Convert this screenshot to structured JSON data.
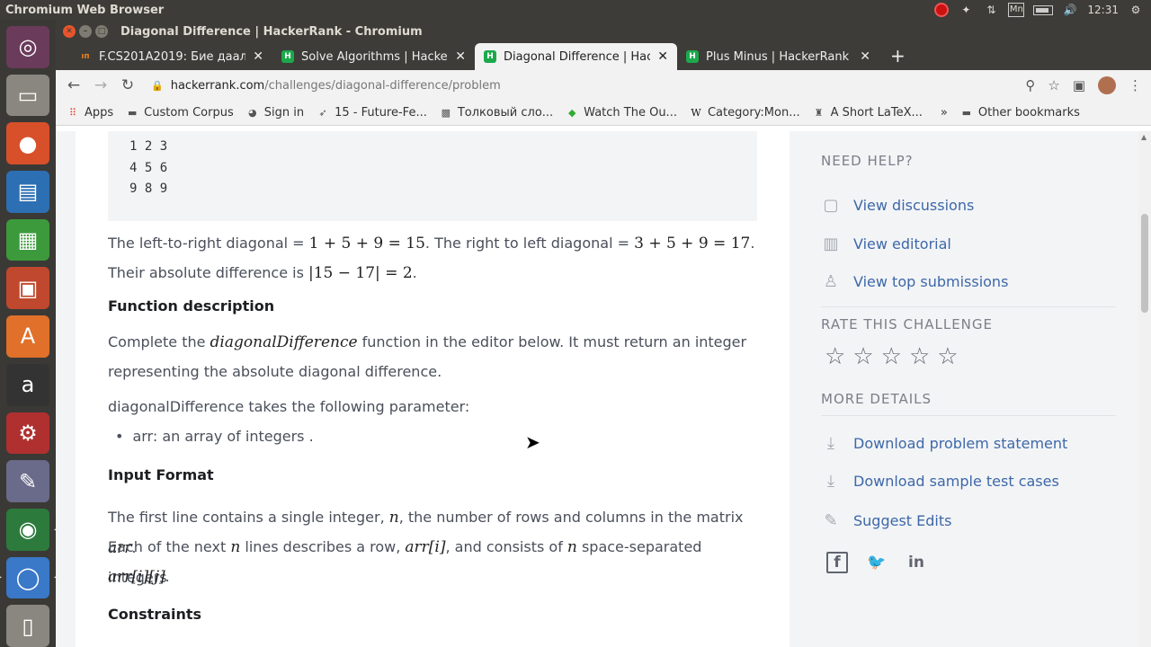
{
  "topbar": {
    "title": "Chromium Web Browser",
    "indicator_mn": "Mn",
    "clock": "12:31"
  },
  "window": {
    "title": "Diagonal Difference | HackerRank - Chromium"
  },
  "tabs": [
    {
      "label": "F.CS201A2019: Бие даалт",
      "icon_color": "#e67e22",
      "icon": "ıп"
    },
    {
      "label": "Solve Algorithms | Hacker",
      "icon_color": "#1ba94c",
      "icon": "H"
    },
    {
      "label": "Diagonal Difference | Hac",
      "icon_color": "#1ba94c",
      "icon": "H"
    },
    {
      "label": "Plus Minus | HackerRank",
      "icon_color": "#1ba94c",
      "icon": "H"
    }
  ],
  "url": {
    "host": "hackerrank.com",
    "path": "/challenges/diagonal-difference/problem"
  },
  "bookmarks": {
    "items": [
      "Apps",
      "Custom Corpus",
      "Sign in",
      "15 - Future-Fe...",
      "Толковый сло...",
      "Watch The Ou...",
      "Category:Mon...",
      "A Short LaTeX..."
    ],
    "more": "»",
    "other": "Other bookmarks"
  },
  "problem": {
    "matrix": [
      "1 2 3",
      "4 5 6",
      "9 8 9"
    ],
    "diag_text1": "The left-to-right diagonal = ",
    "diag_math1": "1 + 5 + 9 = 15",
    "diag_text2": ". The right to left diagonal = ",
    "diag_math2": "3 + 5 + 9 = 17",
    "diag_text3": ".",
    "absdiff_text": "Their absolute difference is ",
    "absdiff_math": "|15 − 17| = 2",
    "absdiff_end": ".",
    "function_heading": "Function description",
    "complete_text1": "Complete the ",
    "complete_math": "diagonalDifference",
    "complete_text2": " function in the editor below. It must return an integer",
    "complete_text3": "representing the absolute diagonal difference.",
    "param_intro": "diagonalDifference takes the following parameter:",
    "param_item": "arr: an array of integers .",
    "input_heading": "Input Format",
    "input_text1": "The first line contains a single integer, ",
    "input_n": "n",
    "input_text2": ", the number of rows and columns in the matrix ",
    "input_arr": "arr",
    "input_text3": ".",
    "input_text4": "Each of the next ",
    "input_text5": " lines describes a row, ",
    "input_arri": "arr[i]",
    "input_text6": ", and consists of ",
    "input_text7": " space-separated integers",
    "input_arrij": "arr[i][j]",
    "input_text8": ".",
    "constraints_heading": "Constraints"
  },
  "sidebar": {
    "need_help": "NEED HELP?",
    "view_discussions": "View discussions",
    "view_editorial": "View editorial",
    "view_top": "View top submissions",
    "rate": "RATE THIS CHALLENGE",
    "rating_stars": 0,
    "more_details": "MORE DETAILS",
    "download_statement": "Download problem statement",
    "download_tests": "Download sample test cases",
    "suggest_edits": "Suggest Edits"
  }
}
